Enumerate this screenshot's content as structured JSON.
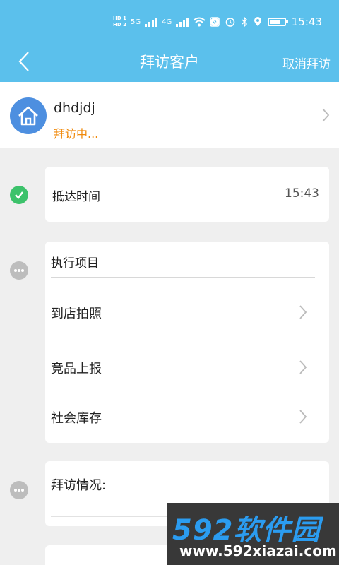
{
  "status_bar": {
    "sim1": "HD 1",
    "sim2": "HD 2",
    "net1": "5G",
    "net2": "4G",
    "time": "15:43"
  },
  "navbar": {
    "title": "拜访客户",
    "cancel_label": "取消拜访"
  },
  "customer": {
    "name": "dhdjdj",
    "status": "拜访中..."
  },
  "arrival": {
    "label": "抵达时间",
    "time": "15:43"
  },
  "tasks": {
    "title": "执行项目",
    "items": [
      {
        "label": "到店拍照"
      },
      {
        "label": "竞品上报"
      },
      {
        "label": "社会库存"
      }
    ]
  },
  "visit_notes": {
    "label": "拜访情况:"
  },
  "watermark": {
    "brand": "592软件园",
    "url": "www.592xiazai.com"
  },
  "colors": {
    "header": "#5bc0ec",
    "status_orange": "#f0890a",
    "done_green": "#3cc26b",
    "avatar_blue": "#4d8fe0"
  }
}
